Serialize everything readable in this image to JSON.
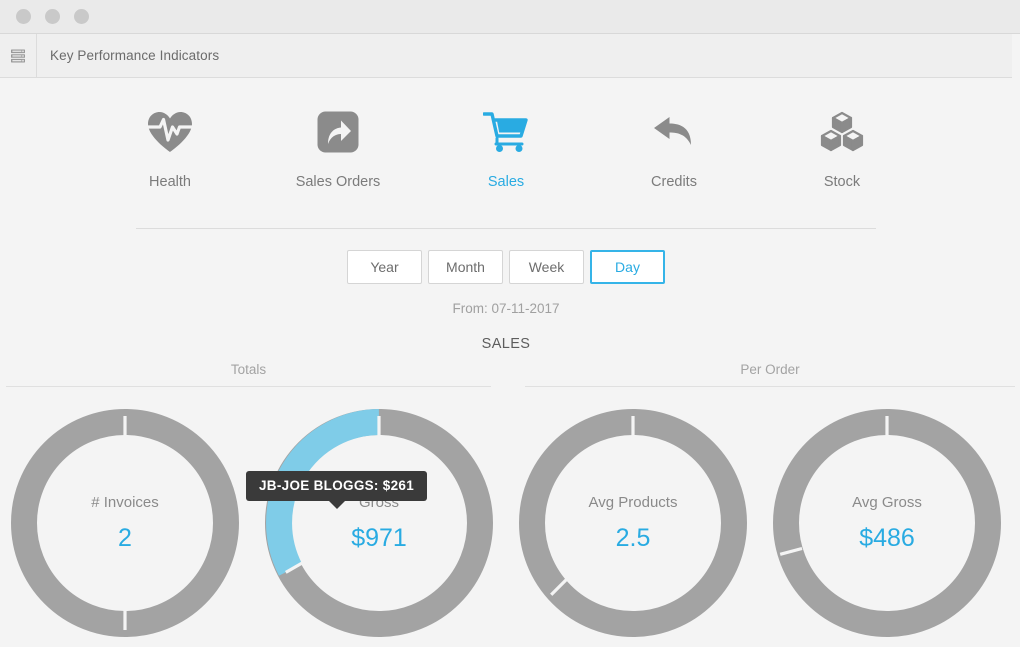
{
  "window": {
    "dots": [
      "close-dot",
      "minimize-dot",
      "maximize-dot"
    ]
  },
  "toolbar": {
    "menu_icon": "list-menu-icon",
    "title": "Key Performance Indicators"
  },
  "kpi_nav": {
    "items": [
      {
        "label": "Health",
        "icon": "heartbeat-icon",
        "active": false
      },
      {
        "label": "Sales Orders",
        "icon": "share-arrow-icon",
        "active": false
      },
      {
        "label": "Sales",
        "icon": "shopping-cart-icon",
        "active": true
      },
      {
        "label": "Credits",
        "icon": "undo-arrow-icon",
        "active": false
      },
      {
        "label": "Stock",
        "icon": "cubes-icon",
        "active": false
      }
    ]
  },
  "period": {
    "options": [
      "Year",
      "Month",
      "Week",
      "Day"
    ],
    "selected": "Day",
    "from_label": "From: 07-11-2017"
  },
  "section": {
    "title": "SALES",
    "groups": [
      {
        "label": "Totals"
      },
      {
        "label": "Per Order"
      }
    ]
  },
  "tooltip": {
    "text": "JB-JOE BLOGGS: $261"
  },
  "colors": {
    "accent": "#29abe2",
    "highlight_arc": "#7fcce8",
    "ring_gray": "#a3a3a3",
    "page_bg": "#f4f4f4"
  },
  "chart_data": [
    {
      "type": "pie",
      "title": "# Invoices",
      "value_label": "2",
      "group": "Totals",
      "total": 2,
      "segments": [
        {
          "name": "segment-1",
          "value": 1,
          "percent": 50,
          "color": "#a3a3a3"
        },
        {
          "name": "segment-2",
          "value": 1,
          "percent": 50,
          "color": "#a3a3a3"
        }
      ]
    },
    {
      "type": "pie",
      "title": "Gross",
      "value_label": "$971",
      "group": "Totals",
      "total": 971,
      "segments": [
        {
          "name": "JB-JOE BLOGGS",
          "value": 261,
          "percent": 26.9,
          "color": "#7fcce8",
          "highlighted": true
        },
        {
          "name": "other",
          "value": 710,
          "percent": 73.1,
          "color": "#a3a3a3"
        }
      ]
    },
    {
      "type": "pie",
      "title": "Avg Products",
      "value_label": "2.5",
      "group": "Per Order",
      "total": 2.5,
      "segments": [
        {
          "name": "segment-1",
          "value": 1.5,
          "percent": 60,
          "color": "#a3a3a3"
        },
        {
          "name": "segment-2",
          "value": 1.0,
          "percent": 40,
          "color": "#a3a3a3"
        }
      ]
    },
    {
      "type": "pie",
      "title": "Avg Gross",
      "value_label": "$486",
      "group": "Per Order",
      "total": 486,
      "segments": [
        {
          "name": "segment-1",
          "value": 340,
          "percent": 70,
          "color": "#a3a3a3"
        },
        {
          "name": "segment-2",
          "value": 146,
          "percent": 30,
          "color": "#a3a3a3"
        }
      ]
    }
  ]
}
